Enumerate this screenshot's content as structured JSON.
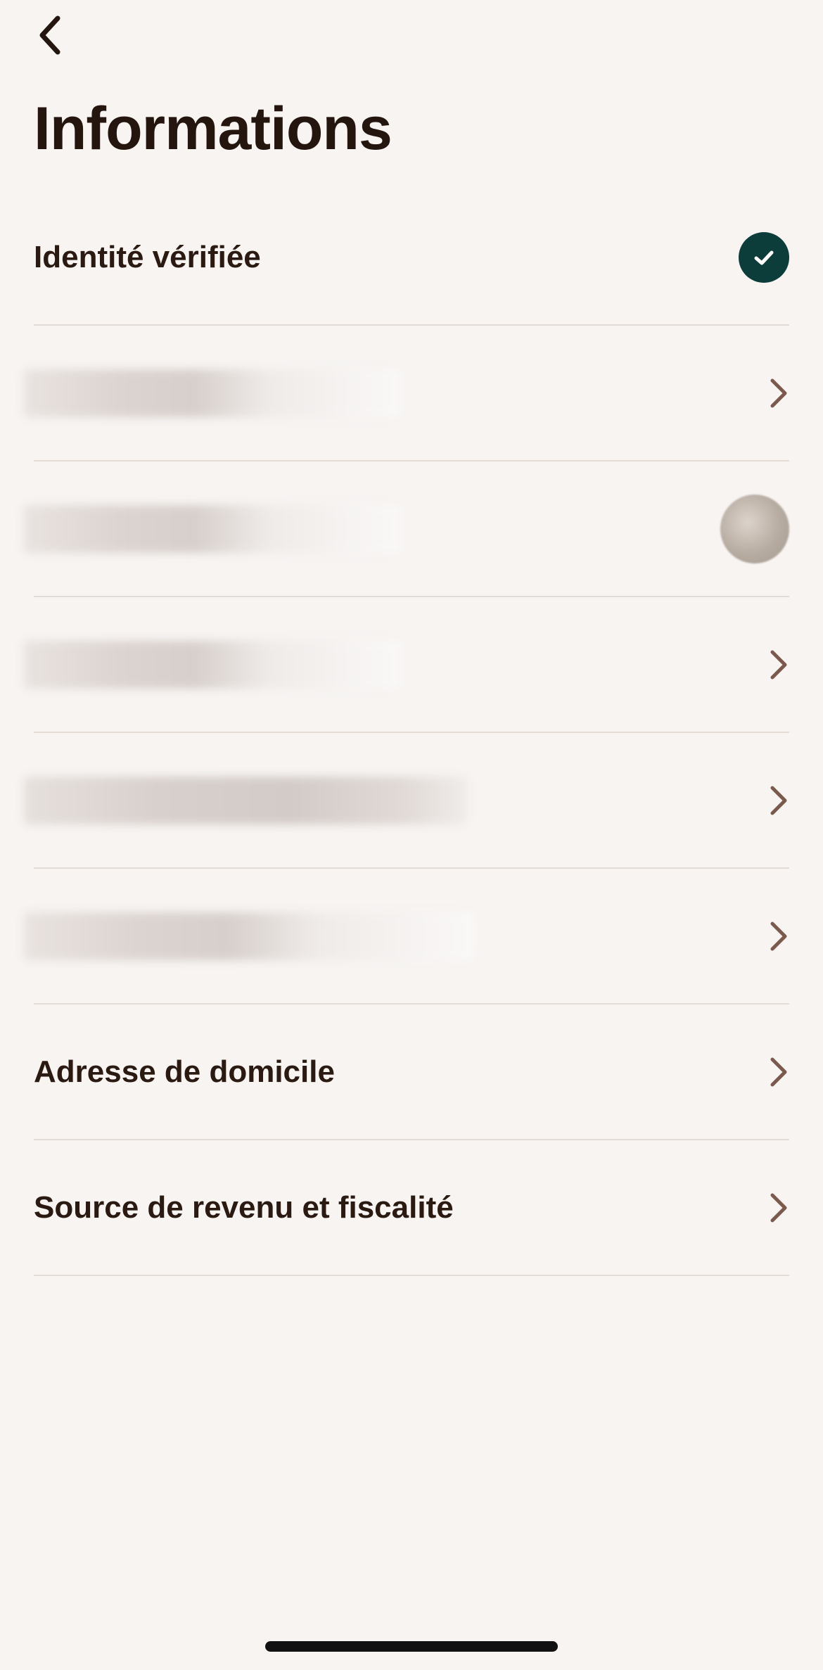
{
  "header": {
    "back_icon": "chevron-left-icon",
    "title": "Informations"
  },
  "rows": [
    {
      "label": "Identité vérifiée",
      "trailing": "check-circle-icon",
      "redacted": false
    },
    {
      "label": "",
      "trailing": "chevron-right-icon",
      "redacted": true
    },
    {
      "label": "",
      "trailing": "avatar",
      "redacted": true
    },
    {
      "label": "",
      "trailing": "chevron-right-icon",
      "redacted": true
    },
    {
      "label": "",
      "trailing": "chevron-right-icon",
      "redacted": true
    },
    {
      "label": "",
      "trailing": "chevron-right-icon",
      "redacted": true
    },
    {
      "label": "Adresse de domicile",
      "trailing": "chevron-right-icon",
      "redacted": false
    },
    {
      "label": "Source de revenu et fiscalité",
      "trailing": "chevron-right-icon",
      "redacted": false
    }
  ],
  "colors": {
    "background": "#F7F4F2",
    "text": "#2A1A12",
    "check_badge": "#0D3D3A",
    "chevron": "#7A5A4C",
    "divider": "#E3DBD5"
  }
}
